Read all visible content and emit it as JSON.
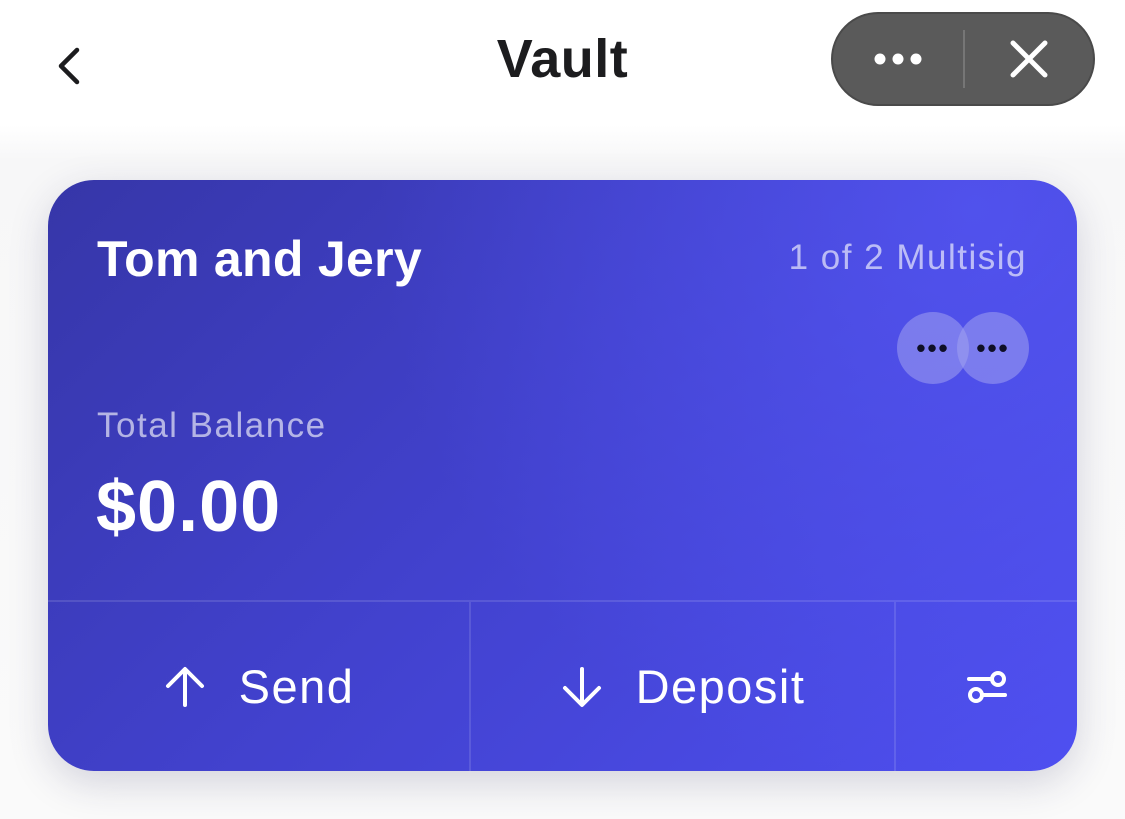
{
  "header": {
    "title": "Vault",
    "back_icon": "chevron-left-icon",
    "more_icon": "more-horizontal-icon",
    "close_icon": "close-icon"
  },
  "card": {
    "vault_name": "Tom and Jery",
    "multisig_label": "1 of 2 Multisig",
    "signers": [
      "•••",
      "•••"
    ],
    "balance_label": "Total Balance",
    "balance_value": "$0.00",
    "actions": {
      "send_label": "Send",
      "deposit_label": "Deposit",
      "send_icon": "arrow-up-icon",
      "deposit_icon": "arrow-down-icon",
      "settings_icon": "sliders-icon"
    }
  },
  "colors": {
    "card_gradient_start": "#3636a8",
    "card_gradient_end": "#4e4ff0",
    "capsule_bg": "#5a5a5a",
    "title_text": "#1c1c1e"
  }
}
